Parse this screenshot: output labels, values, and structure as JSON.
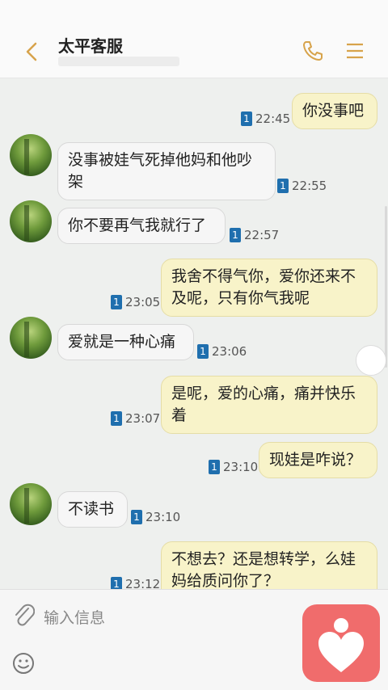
{
  "header": {
    "title": "太平客服",
    "back_icon": "chevron-left-icon",
    "call_icon": "phone-icon",
    "menu_icon": "menu-icon",
    "accent": "#d7a34b"
  },
  "messages": [
    {
      "side": "out",
      "text": "你没事吧",
      "time": "22:45",
      "read": "1"
    },
    {
      "side": "in",
      "text": "没事被娃气死掉他妈和他吵架",
      "time": "22:55",
      "read": "1"
    },
    {
      "side": "in",
      "text": "你不要再气我就行了",
      "time": "22:57",
      "read": "1"
    },
    {
      "side": "out",
      "text": "我舍不得气你，爱你还来不及呢，只有你气我呢",
      "time": "23:05",
      "read": "1"
    },
    {
      "side": "in",
      "text": "爱就是一种心痛",
      "time": "23:06",
      "read": "1"
    },
    {
      "side": "out",
      "text": "是呢，爱的心痛，痛并快乐着",
      "time": "23:07",
      "read": "1"
    },
    {
      "side": "out",
      "text": "现娃是咋说？",
      "time": "23:10",
      "read": "1"
    },
    {
      "side": "in",
      "text": "不读书",
      "time": "23:10",
      "read": "1"
    },
    {
      "side": "out",
      "text": "不想去？还是想转学，么娃妈给质问你了？",
      "time": "23:12",
      "read": "1"
    }
  ],
  "composer": {
    "placeholder": "输入信息",
    "attach_icon": "paperclip-icon",
    "emoji_icon": "smiley-icon",
    "app_icon": "heart-logo-icon",
    "app_color": "#f06c6c"
  },
  "colors": {
    "incoming_bubble": "#f6f6f6",
    "outgoing_bubble": "#f8f3c9",
    "read_badge": "#1f6fae"
  }
}
